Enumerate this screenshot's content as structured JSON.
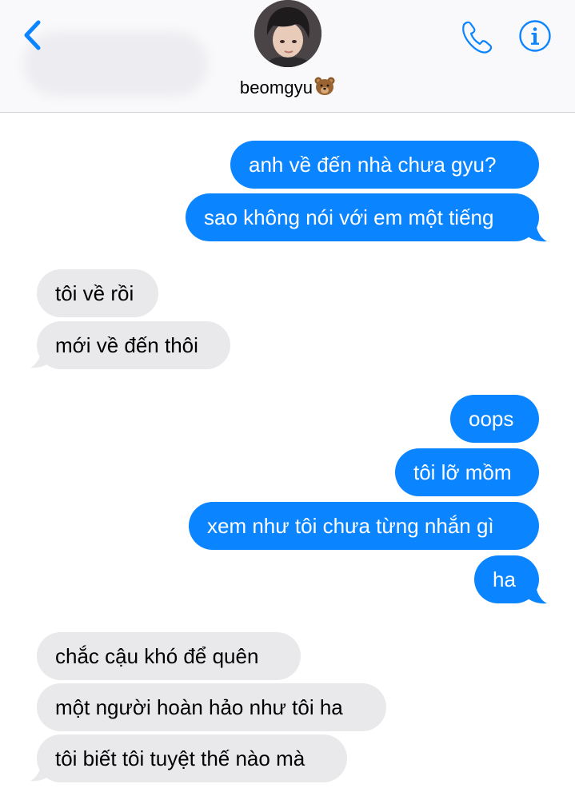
{
  "header": {
    "contact_name": "beomgyu",
    "contact_emoji_name": "bear-face-emoji",
    "accent_color": "#0a84ff",
    "icons": [
      "chevron-left-icon",
      "phone-icon",
      "info-icon"
    ]
  },
  "colors": {
    "sent_bubble": "#0a84ff",
    "received_bubble": "#e9e9eb"
  },
  "messages": [
    {
      "direction": "sent",
      "text": "anh về đến nhà chưa gyu?"
    },
    {
      "direction": "sent",
      "text": "sao không nói với em một tiếng"
    },
    {
      "direction": "received",
      "text": "tôi về rồi"
    },
    {
      "direction": "received",
      "text": "mới về đến thôi"
    },
    {
      "direction": "sent",
      "text": "oops"
    },
    {
      "direction": "sent",
      "text": "tôi lỡ mồm"
    },
    {
      "direction": "sent",
      "text": "xem như tôi chưa từng nhắn gì"
    },
    {
      "direction": "sent",
      "text": "ha"
    },
    {
      "direction": "received",
      "text": "chắc cậu khó để quên"
    },
    {
      "direction": "received",
      "text": "một người hoàn hảo như tôi ha"
    },
    {
      "direction": "received",
      "text": "tôi biết tôi tuyệt thế nào mà"
    }
  ]
}
